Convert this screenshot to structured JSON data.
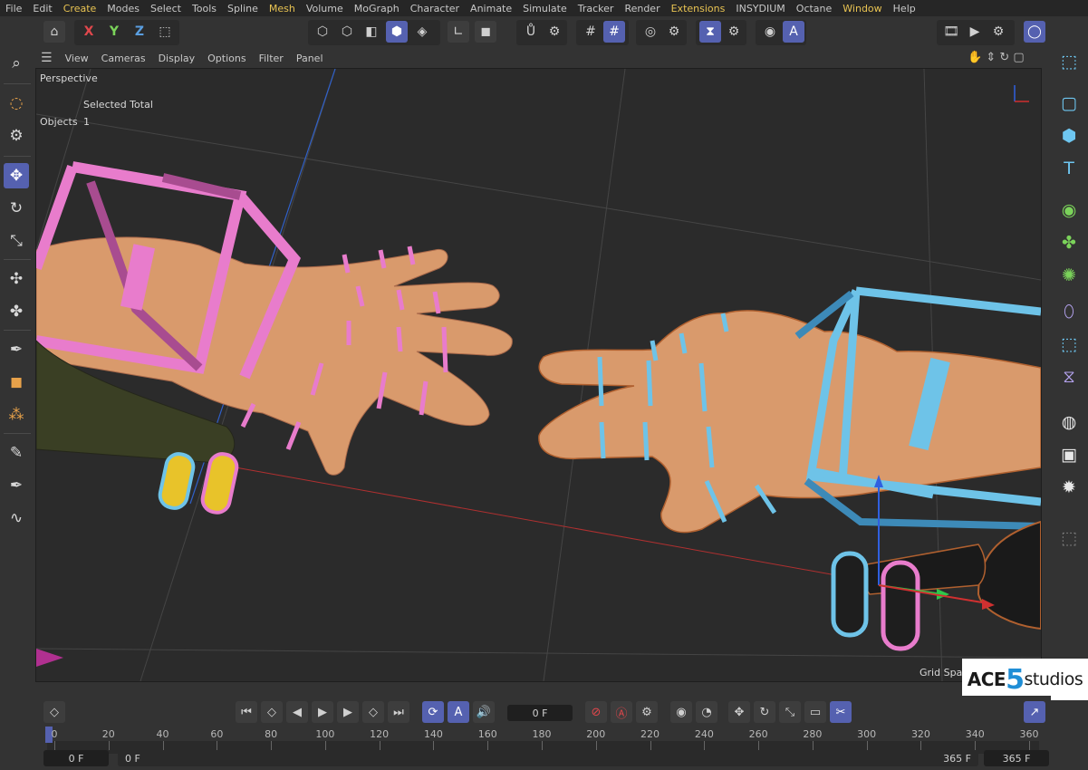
{
  "menu": [
    "File",
    "Edit",
    "Create",
    "Modes",
    "Select",
    "Tools",
    "Spline",
    "Mesh",
    "Volume",
    "MoGraph",
    "Character",
    "Animate",
    "Simulate",
    "Tracker",
    "Render",
    "Extensions",
    "INSYDIUM",
    "Octane",
    "Window",
    "Help"
  ],
  "menu_highlighted": [
    "Create",
    "Mesh",
    "Extensions",
    "Window"
  ],
  "toolbar": {
    "axis_x": "X",
    "axis_y": "Y",
    "axis_z": "Z",
    "accent_color": "#5561b0"
  },
  "viewport_menu": [
    "View",
    "Cameras",
    "Display",
    "Options",
    "Filter",
    "Panel"
  ],
  "viewport": {
    "camera": "Perspective",
    "hud_header": "Selected Total",
    "hud_label": "Objects",
    "hud_value": "1",
    "grid_label": "Grid Spacin",
    "colors": {
      "left_hand_controller": "#e87ccc",
      "right_hand_controller": "#6ec3e8",
      "skin": "#d99a6c",
      "background": "#2b2b2b"
    }
  },
  "timeline": {
    "current_frame": "0 F",
    "start_frame": "0 F",
    "range_start": "0 F",
    "range_end": "365 F",
    "end_frame": "365 F",
    "ticks": [
      "0",
      "20",
      "40",
      "60",
      "80",
      "100",
      "120",
      "140",
      "160",
      "180",
      "200",
      "220",
      "240",
      "260",
      "280",
      "300",
      "320",
      "340",
      "360"
    ]
  },
  "logo": {
    "part1": "ACE",
    "part2": "5",
    "part3": "studios"
  }
}
